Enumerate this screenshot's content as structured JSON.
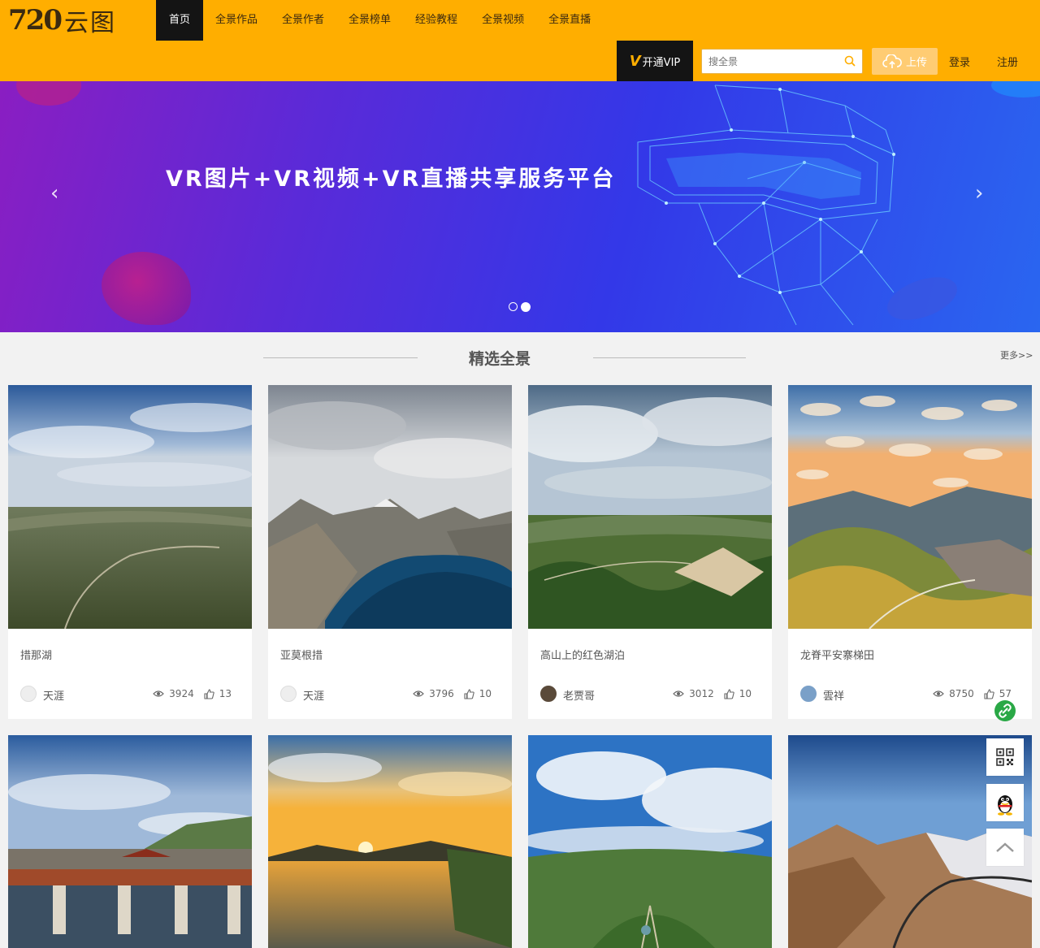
{
  "header": {
    "logo_number": "720",
    "logo_text": "云图",
    "nav": [
      "首页",
      "全景作品",
      "全景作者",
      "全景榜单",
      "经验教程",
      "全景视频",
      "全景直播"
    ],
    "vip_mark": "V",
    "vip_label": "开通VIP",
    "search_placeholder": "搜全景",
    "upload_label": "上传",
    "login_label": "登录",
    "register_label": "注册",
    "accent_color": "#ffae00"
  },
  "banner": {
    "text": "VR图片+VR视频+VR直播共享服务平台",
    "prev_arrow": "‹",
    "next_arrow": "›",
    "slide_count": 2,
    "active_slide": 2
  },
  "section": {
    "title": "精选全景",
    "more_label": "更多>>"
  },
  "cards": [
    {
      "title": "措那湖",
      "author": "天涯",
      "views": "3924",
      "likes": "13",
      "icon": "landscape"
    },
    {
      "title": "亚莫根措",
      "author": "天涯",
      "views": "3796",
      "likes": "10",
      "icon": "landscape"
    },
    {
      "title": "高山上的红色湖泊",
      "author": "老贾哥",
      "views": "3012",
      "likes": "10",
      "icon": "landscape"
    },
    {
      "title": "龙脊平安寨梯田",
      "author": "雲祥",
      "views": "8750",
      "likes": "57",
      "icon": "landscape"
    }
  ],
  "side_tools": [
    "link-icon",
    "qrcode-icon",
    "qq-icon",
    "back-to-top-icon"
  ]
}
